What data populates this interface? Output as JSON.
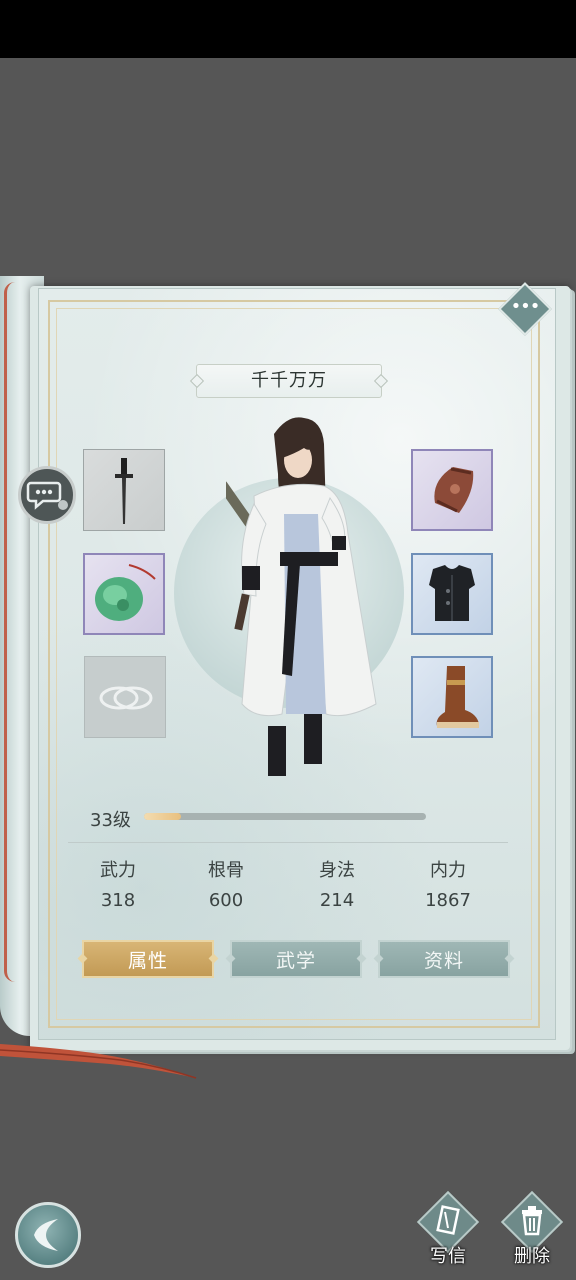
{
  "character": {
    "name": "千千万万",
    "level_label": "33级",
    "level_progress": 0.13
  },
  "equipment": {
    "left": [
      {
        "slot": "weapon",
        "item": "dagger",
        "rarity": "gray"
      },
      {
        "slot": "accessory",
        "item": "jade-pendant",
        "rarity": "purple"
      },
      {
        "slot": "ring",
        "item": "silver-rings",
        "rarity": "empty"
      }
    ],
    "right": [
      {
        "slot": "bracer",
        "item": "leather-bracer",
        "rarity": "purple"
      },
      {
        "slot": "armor",
        "item": "black-vest",
        "rarity": "blue"
      },
      {
        "slot": "boots",
        "item": "leather-boots",
        "rarity": "blue"
      }
    ]
  },
  "stats": [
    {
      "label": "武力",
      "value": "318"
    },
    {
      "label": "根骨",
      "value": "600"
    },
    {
      "label": "身法",
      "value": "214"
    },
    {
      "label": "内力",
      "value": "1867"
    }
  ],
  "tabs": [
    {
      "label": "属性",
      "active": true
    },
    {
      "label": "武学",
      "active": false
    },
    {
      "label": "资料",
      "active": false
    }
  ],
  "actions": {
    "write_letter": "写信",
    "delete": "删除"
  },
  "icons": {
    "more": "more-dots-icon",
    "chat": "chat-bubble-icon",
    "back": "back-arrow-icon",
    "letter": "letter-icon",
    "trash": "trash-icon"
  },
  "colors": {
    "active_tab": "#c9a461",
    "inactive_tab": "#8ea8a6",
    "page": "#dde8e6",
    "background": "#565656"
  }
}
